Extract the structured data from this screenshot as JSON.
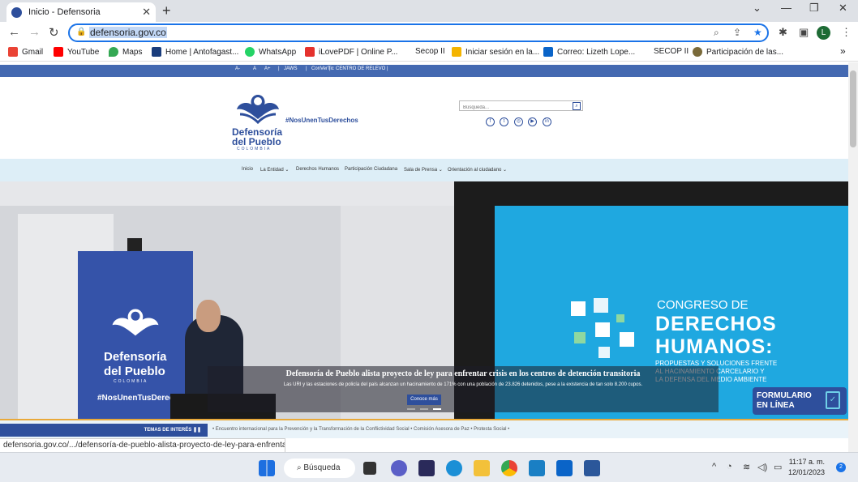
{
  "browser": {
    "tab_title": "Inicio - Defensoria",
    "tab_close": "✕",
    "new_tab": "+",
    "url": "defensoria.gov.co",
    "profile_initial": "L",
    "window_controls": [
      "⌄",
      "—",
      "❐",
      "✕"
    ]
  },
  "bookmarks": [
    {
      "label": "Gmail",
      "color": "#ea4335"
    },
    {
      "label": "YouTube",
      "color": "#ff0000"
    },
    {
      "label": "Maps",
      "color": "#34a853"
    },
    {
      "label": "Home | Antofagast...",
      "color": "#1a3d7c"
    },
    {
      "label": "WhatsApp",
      "color": "#25d366"
    },
    {
      "label": "iLovePDF | Online P...",
      "color": "#e5322d"
    },
    {
      "label": "Secop II",
      "color": ""
    },
    {
      "label": "Iniciar sesión en la...",
      "color": "#f4b400"
    },
    {
      "label": "Correo: Lizeth Lope...",
      "color": "#0a64c8"
    },
    {
      "label": "SECOP II",
      "color": ""
    },
    {
      "label": "Participación de las...",
      "color": "#7a6a3a"
    }
  ],
  "bookmarks_more": "»",
  "site": {
    "topstrip": [
      "A-",
      "A",
      "A+",
      "|",
      "JAWS",
      "|",
      "ConVerTic",
      "|",
      "CENTRO DE RELEVO",
      "|"
    ],
    "logo_line1": "Defensoría",
    "logo_line2": "del Pueblo",
    "logo_country": "COLOMBIA",
    "hashtag": "#NosUnenTusDerechos",
    "search_placeholder": "Búsqueda...",
    "social": [
      "f",
      "t",
      "◎",
      "▶",
      "in"
    ],
    "menu": [
      "Inicio",
      "La Entidad ⌄",
      "Derechos Humanos",
      "Participación Ciudadana",
      "Sala de Prensa ⌄",
      "Orientación al ciudadano ⌄"
    ]
  },
  "hero": {
    "headline": "Defensoría de Pueblo alista proyecto de ley para enfrentar crisis en los centros de detención transitoria",
    "subtext": "Las URI y las estaciones de policía del país alcanzan un hacinamiento de 171% con una población de 23.826 detenidos, pese a la existencia de tan solo 8.200 cupos.",
    "cta": "Conoce más",
    "banner_line1": "CONGRESO DE",
    "banner_line2": "DERECHOS",
    "banner_line3": "HUMANOS:",
    "banner_sub1": "PROPUESTAS Y SOLUCIONES FRENTE",
    "banner_sub2": "AL HACINAMIENTO CARCELARIO Y",
    "banner_sub3": "LA DEFENSA DEL MEDIO AMBIENTE",
    "form_line1": "FORMULARIO",
    "form_line2": "EN LÍNEA",
    "flag_logo1": "Defensoría",
    "flag_logo2": "del Pueblo",
    "flag_country": "COLOMBIA",
    "flag_hashtag": "#NosUnenTusDerechos"
  },
  "interest": {
    "label": "TEMAS DE INTERÉS",
    "topics": "•  Encuentro internacional para la Prevención y la Transformación de la Conflictividad Social   •  Comisión Asesora de Paz   •  Protesta Social   •"
  },
  "status_url": "defensoria.gov.co/.../defensoría-de-pueblo-alista-proyecto-de-ley-para-enfrentar...",
  "taskbar": {
    "search_label": "Búsqueda",
    "time": "11:17 a. m.",
    "date": "12/01/2023",
    "notifications": "2"
  },
  "colors": {
    "brand_blue": "#2e4f9c",
    "strip_blue": "#4469b1",
    "banner_cyan": "#1fa8e0",
    "chrome_focus": "#1a73e8"
  }
}
